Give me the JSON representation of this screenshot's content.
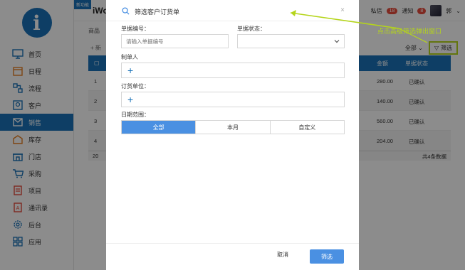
{
  "sidebar": {
    "logo": "i",
    "items": [
      {
        "label": "首页",
        "icon": "monitor-icon"
      },
      {
        "label": "日程",
        "icon": "calendar-icon"
      },
      {
        "label": "流程",
        "icon": "flow-icon"
      },
      {
        "label": "客户",
        "icon": "customer-icon"
      },
      {
        "label": "销售",
        "icon": "sales-icon",
        "active": true
      },
      {
        "label": "库存",
        "icon": "warehouse-icon"
      },
      {
        "label": "门店",
        "icon": "store-icon"
      },
      {
        "label": "采购",
        "icon": "cart-icon"
      },
      {
        "label": "项目",
        "icon": "project-icon"
      },
      {
        "label": "通讯录",
        "icon": "contacts-icon"
      },
      {
        "label": "后台",
        "icon": "settings-icon"
      },
      {
        "label": "应用",
        "icon": "apps-icon"
      }
    ]
  },
  "topbar": {
    "new_badge": "新功能",
    "brand": "iWo",
    "messages_label": "私信",
    "messages_count": "18",
    "notices_label": "通知",
    "notices_count": "8",
    "user": "郭"
  },
  "main": {
    "subtab": "商品",
    "add_label": "+ 新",
    "range_value": "全部",
    "filter_label": "筛选",
    "columns": {
      "amount": "金额",
      "status": "单据状态"
    },
    "rows": [
      {
        "num": "1",
        "amount": "280.00",
        "status": "已确认"
      },
      {
        "num": "2",
        "amount": "140.00",
        "status": "已确认"
      },
      {
        "num": "3",
        "amount": "560.00",
        "status": "已确认"
      },
      {
        "num": "4",
        "amount": "204.00",
        "status": "已确认"
      }
    ],
    "page_size": "20",
    "total": "共4条数据"
  },
  "modal": {
    "title": "筛选客户订货单",
    "close": "×",
    "order_no_label": "单据编号：",
    "order_no_placeholder": "请输入单据编号",
    "status_label": "单据状态：",
    "creator_label": "制单人",
    "unit_label": "订货单位：",
    "date_label": "日期范围：",
    "date_options": [
      "全部",
      "本月",
      "自定义"
    ],
    "date_selected": "全部",
    "cancel": "取消",
    "confirm": "筛选"
  },
  "annotation": {
    "text": "点击高级筛选弹出窗口",
    "color": "#b5d51a"
  },
  "colors": {
    "primary": "#1a72b8",
    "button": "#4a90e2",
    "badge": "#e74c3c"
  }
}
